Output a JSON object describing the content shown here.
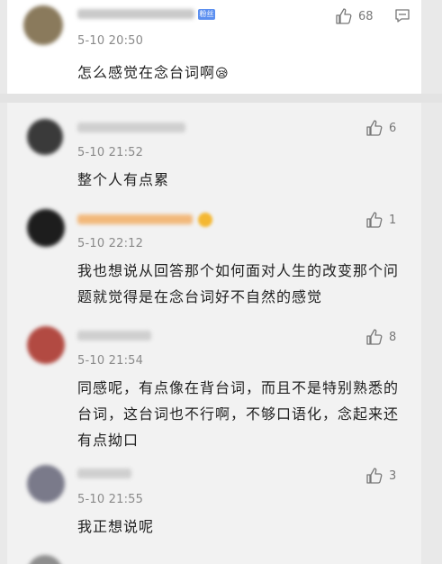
{
  "main_comment": {
    "badge": "粉丝",
    "time": "5-10 20:50",
    "text": "怎么感觉在念台词啊",
    "emoji": "😪",
    "likes": "68",
    "avatar_color": "#8a7a5c"
  },
  "replies": [
    {
      "time": "5-10 21:52",
      "text": "整个人有点累",
      "likes": "6",
      "avatar_color": "#3a3a3a",
      "name_color": "#c8c8c8"
    },
    {
      "time": "5-10 22:12",
      "text": "我也想说从回答那个如何面对人生的改变那个问题就觉得是在念台词好不自然的感觉",
      "likes": "1",
      "avatar_color": "#1d1d1d",
      "name_color": "#f2b87a"
    },
    {
      "time": "5-10 21:54",
      "text": "同感呢，有点像在背台词，而且不是特别熟悉的台词，这台词也不行啊，不够口语化，念起来还有点拗口",
      "likes": "8",
      "avatar_color": "#b24a42",
      "name_color": "#c8c8c8"
    },
    {
      "time": "5-10 21:55",
      "text": "我正想说呢",
      "likes": "3",
      "avatar_color": "#7a7a8a",
      "name_color": "#c8c8c8"
    }
  ],
  "colors": {
    "accent_badge": "#5b8ff0",
    "gold": "#f4b731"
  }
}
